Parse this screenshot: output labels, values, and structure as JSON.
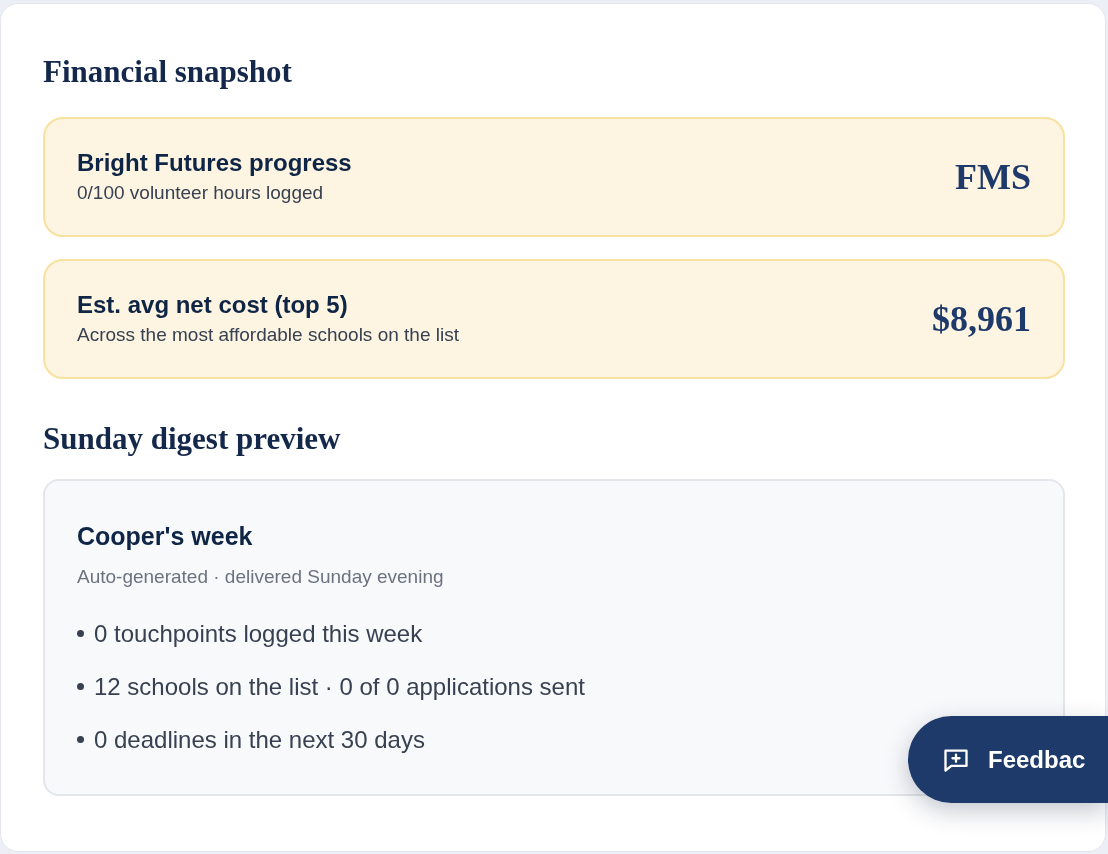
{
  "financial_snapshot": {
    "heading": "Financial snapshot",
    "cards": [
      {
        "title": "Bright Futures progress",
        "subtitle": "0/100 volunteer hours logged",
        "value": "FMS"
      },
      {
        "title": "Est. avg net cost (top 5)",
        "subtitle": "Across the most affordable schools on the list",
        "value": "$8,961"
      }
    ]
  },
  "digest_preview": {
    "heading": "Sunday digest preview",
    "card": {
      "title": "Cooper's week",
      "subtitle": "Auto-generated · delivered Sunday evening",
      "items": [
        "0 touchpoints logged this week",
        "12 schools on the list · 0 of 0 applications sent",
        "0 deadlines in the next 30 days"
      ]
    }
  },
  "feedback_button": {
    "label": "Feedbac"
  }
}
